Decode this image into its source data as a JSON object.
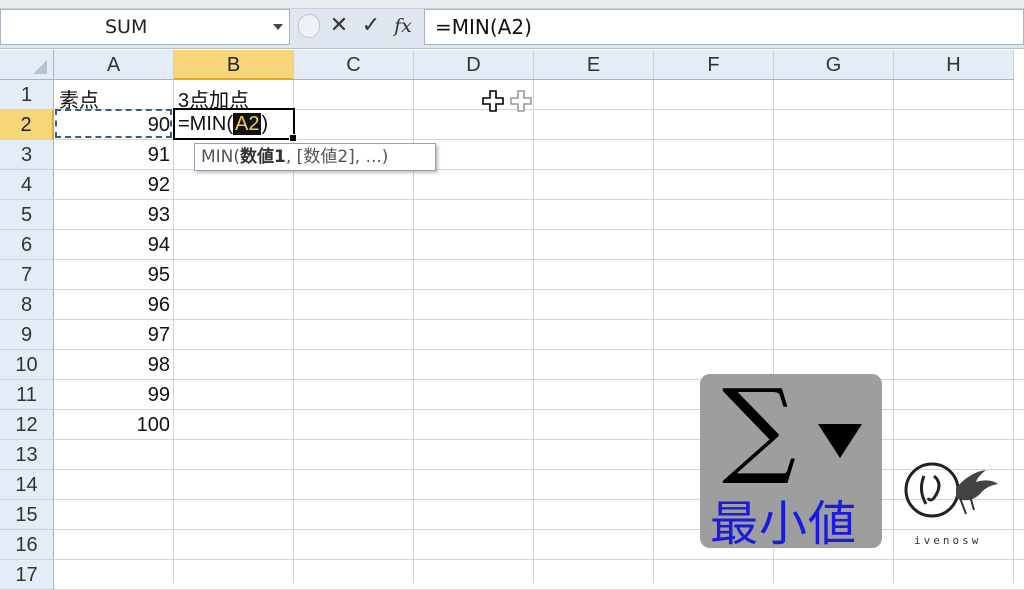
{
  "formula_bar": {
    "name_box": "SUM",
    "cancel_symbol": "✕",
    "enter_symbol": "✓",
    "fx_symbol": "fx",
    "formula": "=MIN(A2)"
  },
  "columns": [
    "A",
    "B",
    "C",
    "D",
    "E",
    "F",
    "G",
    "H"
  ],
  "rows": [
    "1",
    "2",
    "3",
    "4",
    "5",
    "6",
    "7",
    "8",
    "9",
    "10",
    "11",
    "12",
    "13",
    "14",
    "15",
    "16",
    "17"
  ],
  "cells": {
    "A1": "素点",
    "B1": "3点加点",
    "A_values": [
      "90",
      "91",
      "92",
      "93",
      "94",
      "95",
      "96",
      "97",
      "98",
      "99",
      "100"
    ]
  },
  "active_cell": {
    "edit_prefix": "=MIN(",
    "edit_ref": "A2",
    "edit_suffix": ")"
  },
  "tooltip": {
    "fn": "MIN(",
    "arg1": "数値1",
    "rest": ", [数値2], ...)"
  },
  "badge": {
    "sigma": "∑",
    "label": "最小値"
  },
  "logo": {
    "watermark": "ivenosw"
  },
  "colors": {
    "selected_header": "#f7d67a",
    "header_bg": "#e4ecf7",
    "badge_text": "#1a1ae0",
    "ref_highlight_bg": "#111111",
    "ref_highlight_text": "#f0d050"
  },
  "selected": {
    "column": "B",
    "row": "2"
  }
}
